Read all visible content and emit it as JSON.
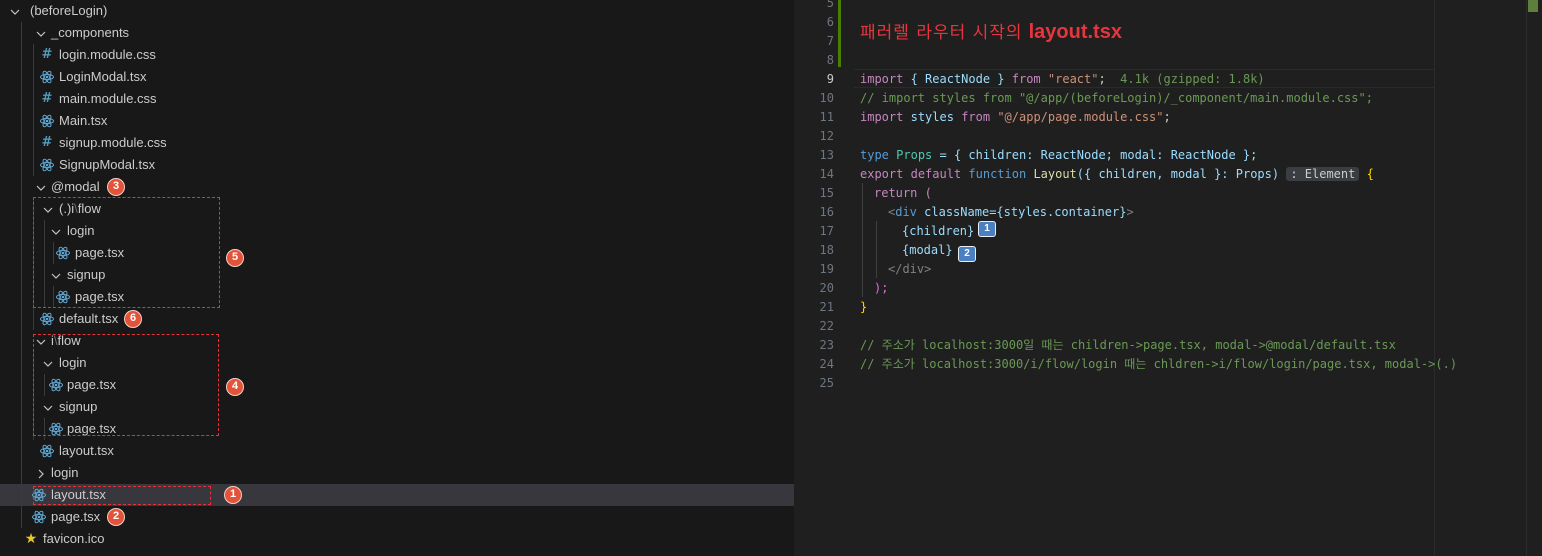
{
  "explorer": {
    "items": [
      {
        "label": "(beforeLogin)",
        "kind": "folder-open"
      },
      {
        "label": "_components",
        "kind": "folder-open"
      },
      {
        "label": "login.module.css",
        "kind": "css"
      },
      {
        "label": "LoginModal.tsx",
        "kind": "react"
      },
      {
        "label": "main.module.css",
        "kind": "css"
      },
      {
        "label": "Main.tsx",
        "kind": "react"
      },
      {
        "label": "signup.module.css",
        "kind": "css"
      },
      {
        "label": "SignupModal.tsx",
        "kind": "react"
      },
      {
        "label": "@modal",
        "kind": "folder-open",
        "badge": "3"
      },
      {
        "label_parts": [
          "(.)i",
          "\\",
          "flow"
        ],
        "kind": "folder-open"
      },
      {
        "label": "login",
        "kind": "folder-open"
      },
      {
        "label": "page.tsx",
        "kind": "react"
      },
      {
        "label": "signup",
        "kind": "folder-open"
      },
      {
        "label": "page.tsx",
        "kind": "react"
      },
      {
        "label": "default.tsx",
        "kind": "react",
        "badge": "6"
      },
      {
        "label_parts": [
          "i",
          "\\",
          "flow"
        ],
        "kind": "folder-open"
      },
      {
        "label": "login",
        "kind": "folder-open"
      },
      {
        "label": "page.tsx",
        "kind": "react"
      },
      {
        "label": "signup",
        "kind": "folder-open"
      },
      {
        "label": "page.tsx",
        "kind": "react"
      },
      {
        "label": "layout.tsx",
        "kind": "react"
      },
      {
        "label": "login",
        "kind": "folder-closed"
      },
      {
        "label": "layout.tsx",
        "kind": "react",
        "badge": "1",
        "selected": true
      },
      {
        "label": "page.tsx",
        "kind": "react",
        "badge": "2"
      },
      {
        "label": "favicon.ico",
        "kind": "star"
      }
    ],
    "box_badges": {
      "modal_group": "5",
      "flow_group": "4"
    }
  },
  "editor": {
    "heading_korean": "패러렐 라우터 시작의",
    "heading_file": "layout.tsx",
    "line_numbers": [
      "5",
      "6",
      "7",
      "8",
      "9",
      "10",
      "11",
      "12",
      "13",
      "14",
      "15",
      "16",
      "17",
      "18",
      "19",
      "20",
      "21",
      "22",
      "23",
      "24",
      "25"
    ],
    "active_line": "9",
    "import_size_hint": "4.1k (gzipped: 1.8k)",
    "type_hint": ": Element",
    "code": {
      "l9_import": "import",
      "l9_names": "{ ReactNode }",
      "l9_from": "from",
      "l9_mod": "\"react\"",
      "l10": "// import styles from \"@/app/(beforeLogin)/_component/main.module.css\";",
      "l11_import": "import",
      "l11_name": "styles",
      "l11_from": "from",
      "l11_mod": "\"@/app/page.module.css\"",
      "l13_type": "type",
      "l13_name": "Props",
      "l13_body": "= { children: ReactNode; modal: ReactNode };",
      "l14_export": "export",
      "l14_default": "default",
      "l14_function": "function",
      "l14_fn": "Layout",
      "l14_params": "({ children, modal }: Props)",
      "l15": "return (",
      "l16_open": "<",
      "l16_tag": "div",
      "l16_attr": "className",
      "l16_val": "={styles.container}",
      "l16_close": ">",
      "l17": "{children}",
      "l18": "{modal}",
      "l19": "</div>",
      "l20": ");",
      "l21": "}",
      "l23": "// 주소가 localhost:3000일 때는 children->page.tsx, modal->@modal/default.tsx",
      "l24": "// 주소가 localhost:3000/i/flow/login 때는 chldren->i/flow/login/page.tsx, modal->(.)"
    },
    "code_badges": {
      "children": "1",
      "modal": "2"
    }
  },
  "colors": {
    "accent_red": "#e8353d",
    "badge_orange": "#e2533a",
    "badge_blue": "#4a7fc1"
  }
}
